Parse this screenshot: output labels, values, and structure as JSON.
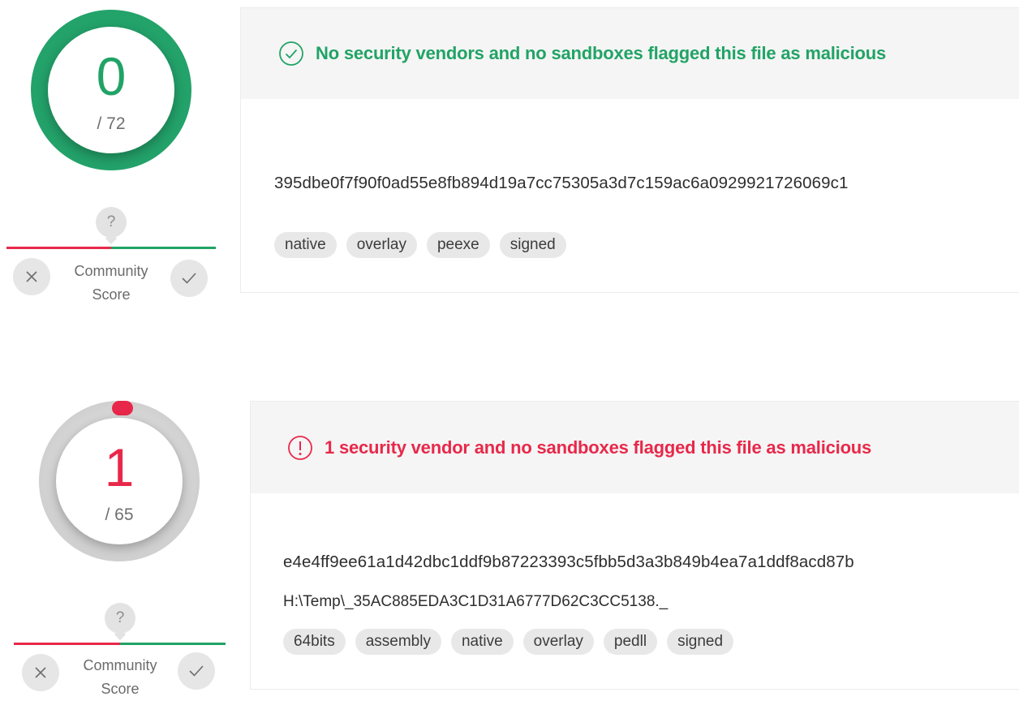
{
  "reports": [
    {
      "score": {
        "detections": "0",
        "total": "/ 72",
        "color": "#21a366",
        "detection_ratio": 0
      },
      "community": {
        "pin": "?",
        "label_line1": "Community",
        "label_line2": "Score"
      },
      "status": {
        "type": "clean",
        "icon": "check-circle-icon",
        "color": "#21a366",
        "text": "No security vendors and no sandboxes flagged this file as malicious"
      },
      "hash": "395dbe0f7f90f0ad55e8fb894d19a7cc75305a3d7c159ac6a0929921726069c1",
      "tags": [
        "native",
        "overlay",
        "peexe",
        "signed"
      ]
    },
    {
      "score": {
        "detections": "1",
        "total": "/ 65",
        "color": "#e8284a",
        "detection_ratio": 0.0154
      },
      "community": {
        "pin": "?",
        "label_line1": "Community",
        "label_line2": "Score"
      },
      "status": {
        "type": "malicious",
        "icon": "alert-circle-icon",
        "color": "#e8284a",
        "text": "1 security vendor and no sandboxes flagged this file as malicious"
      },
      "hash": "e4e4ff9ee61a1d42dbc1ddf9b87223393c5fbb5d3a3b849b4ea7a1ddf8acd87b",
      "file_name": "H:\\Temp\\_35AC885EDA3C1D31A6777D62C3CC5138._",
      "tags": [
        "64bits",
        "assembly",
        "native",
        "overlay",
        "pedll",
        "signed"
      ]
    }
  ]
}
